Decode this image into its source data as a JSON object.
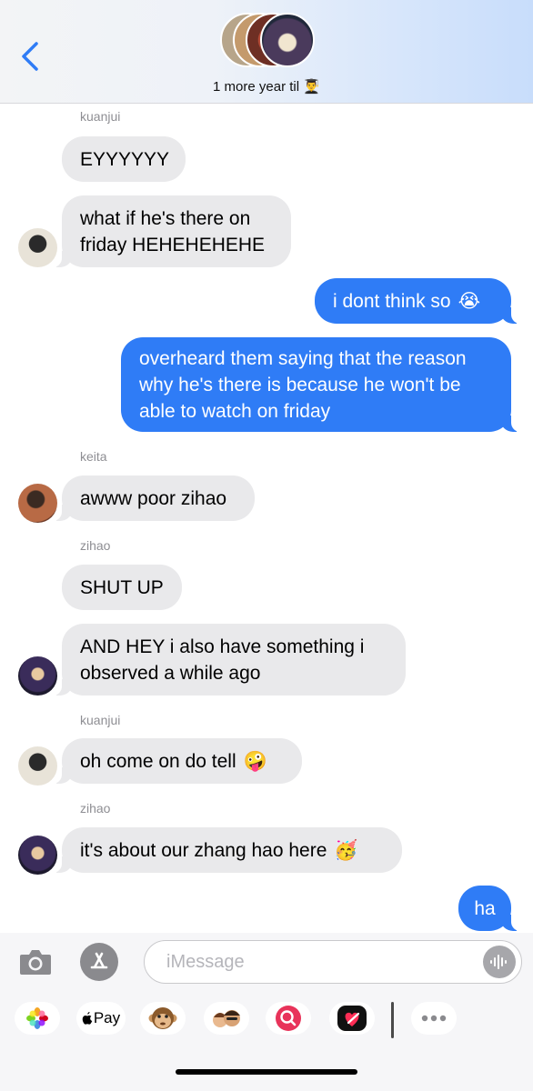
{
  "header": {
    "title": "1 more year til",
    "title_emoji": "👨‍🎓"
  },
  "messages": [
    {
      "sender": "kuanjui",
      "text": "EYYYYYY",
      "direction": "in"
    },
    {
      "text_line1": "what if he's there on",
      "text_line2": "friday HEHEHEHEHE",
      "direction": "in"
    },
    {
      "text": "i dont think so",
      "emoji": "😭",
      "direction": "out"
    },
    {
      "text_line1": "overheard them saying that the reason",
      "text_line2": "why he's there is because he won't be",
      "text_line3": "able to watch on friday",
      "direction": "out"
    },
    {
      "sender": "keita",
      "text": "awww poor zihao",
      "direction": "in"
    },
    {
      "sender": "zihao",
      "text": "SHUT UP",
      "direction": "in"
    },
    {
      "text_line1": "AND HEY i also have something i",
      "text_line2": "observed a while ago",
      "direction": "in"
    },
    {
      "sender": "kuanjui",
      "text": "oh come on do tell",
      "emoji": "🤪",
      "direction": "in"
    },
    {
      "sender": "zihao",
      "text": "it's about our zhang hao here",
      "emoji": "🥳",
      "direction": "in"
    },
    {
      "text": "ha",
      "direction": "out"
    }
  ],
  "composer": {
    "placeholder": "iMessage"
  },
  "drawer": {
    "apple_pay_label": "Pay",
    "apps": [
      "photos-icon",
      "apple-pay-icon",
      "monkey-memoji-icon",
      "memoji-stickers-icon",
      "image-search-icon",
      "digital-touch-icon",
      "more-icon"
    ]
  }
}
